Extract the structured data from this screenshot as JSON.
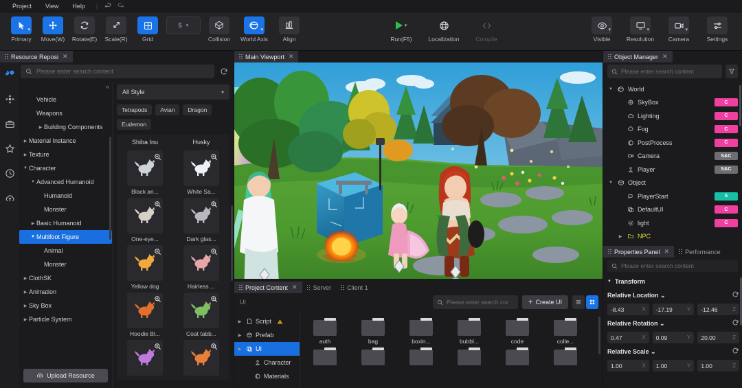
{
  "menu": {
    "items": [
      "Project",
      "View",
      "Help"
    ],
    "separator": "|",
    "undo_icon": "undo-icon",
    "redo_icon": "redo-icon"
  },
  "toolbar": {
    "left_tools": [
      {
        "label": "Primary",
        "icon": "cursor-icon",
        "active": true,
        "caret": true
      },
      {
        "label": "Move(W)",
        "icon": "move-arrows-icon",
        "active": true,
        "caret": false
      },
      {
        "label": "Rotate(E)",
        "icon": "rotate-icon",
        "active": false,
        "caret": false
      },
      {
        "label": "Scale(R)",
        "icon": "scale-diagonal-icon",
        "active": false,
        "caret": false
      },
      {
        "label": "Grid",
        "icon": "grid-icon",
        "active": true,
        "caret": false
      }
    ],
    "grid_value": "5",
    "mid_tools": [
      {
        "label": "Collision",
        "icon": "collision-octahedron-icon",
        "active": false,
        "caret": false
      },
      {
        "label": "World Axis",
        "icon": "world-axis-globe-icon",
        "active": true,
        "caret": true
      },
      {
        "label": "Align",
        "icon": "align-bars-icon",
        "active": false,
        "caret": false
      }
    ],
    "center_tools": [
      {
        "label": "Run(F5)",
        "icon": "play-icon",
        "caret": true,
        "disabled": false
      },
      {
        "label": "Localization",
        "icon": "globe-icon",
        "caret": false,
        "disabled": false
      },
      {
        "label": "Compile",
        "icon": "code-brackets-icon",
        "caret": false,
        "disabled": true
      }
    ],
    "right_tools": [
      {
        "label": "Visible",
        "icon": "eye-icon",
        "caret": true
      },
      {
        "label": "Resolution",
        "icon": "monitor-icon",
        "caret": true
      },
      {
        "label": "Camera",
        "icon": "video-camera-icon",
        "caret": true
      },
      {
        "label": "Settings",
        "icon": "sliders-icon",
        "caret": false
      }
    ]
  },
  "rail": {
    "items": [
      {
        "icon": "resource-library-icon",
        "active": true
      },
      {
        "icon": "move-gizmo-icon",
        "active": false
      },
      {
        "icon": "toolbox-icon",
        "active": false
      },
      {
        "icon": "star-icon",
        "active": false
      },
      {
        "icon": "clock-recent-icon",
        "active": false
      },
      {
        "icon": "cloud-upload-icon",
        "active": false
      }
    ]
  },
  "resource_panel": {
    "tab": "Resource Reposi",
    "tab_close": "✕",
    "search_placeholder": "Please enter search content",
    "search_icon": "search-icon",
    "refresh_icon": "refresh-icon",
    "collapse_icon": "«",
    "tree": [
      {
        "label": "Vehicle",
        "depth": 1,
        "arrow": ""
      },
      {
        "label": "Weapons",
        "depth": 1,
        "arrow": ""
      },
      {
        "label": "Building Components",
        "depth": 2,
        "arrow": "▶"
      },
      {
        "label": "Material Instance",
        "depth": 0,
        "arrow": "▶"
      },
      {
        "label": "Texture",
        "depth": 0,
        "arrow": "▶"
      },
      {
        "label": "Character",
        "depth": 0,
        "arrow": "▼"
      },
      {
        "label": "Advanced Humanoid",
        "depth": 1,
        "arrow": "▼"
      },
      {
        "label": "Humanoid",
        "depth": 2,
        "arrow": ""
      },
      {
        "label": "Monster",
        "depth": 2,
        "arrow": ""
      },
      {
        "label": "Basic Humanoid",
        "depth": 1,
        "arrow": "▶"
      },
      {
        "label": "Multifoot Figure",
        "depth": 1,
        "arrow": "▼",
        "selected": true
      },
      {
        "label": "Animal",
        "depth": 2,
        "arrow": ""
      },
      {
        "label": "Monster",
        "depth": 2,
        "arrow": ""
      },
      {
        "label": "ClothSK",
        "depth": 0,
        "arrow": "▶"
      },
      {
        "label": "Animation",
        "depth": 0,
        "arrow": "▶"
      },
      {
        "label": "Sky Box",
        "depth": 0,
        "arrow": "▶"
      },
      {
        "label": "Particle System",
        "depth": 0,
        "arrow": "▶"
      }
    ],
    "upload_button": "Upload Resource",
    "upload_icon": "upload-cloud-icon",
    "style_select": "All Style",
    "style_caret": "⌄",
    "chips": [
      "Tetrapods",
      "Avian",
      "Dragon",
      "Eudemon"
    ],
    "groups": [
      "Shiba Inu",
      "Husky"
    ],
    "cards": [
      {
        "name": "Black an...",
        "glyph": "🐕",
        "tint": "#cfd3d6"
      },
      {
        "name": "White Sa...",
        "glyph": "🐕",
        "tint": "#eef1f3"
      },
      {
        "name": "One-eye...",
        "glyph": "🐕",
        "tint": "#d8cfc8"
      },
      {
        "name": "Dark glas...",
        "glyph": "🐕",
        "tint": "#b8b9bd"
      },
      {
        "name": "Yellow dog",
        "glyph": "🐕",
        "tint": "#f0a93c"
      },
      {
        "name": "Hairless ...",
        "glyph": "🐕",
        "tint": "#e8a6a8"
      },
      {
        "name": "Hoodie Bl...",
        "glyph": "🐕",
        "tint": "#e0702a"
      },
      {
        "name": "Coat tabb...",
        "glyph": "🐕",
        "tint": "#7fbf62"
      },
      {
        "name": "",
        "glyph": "🐕",
        "tint": "#c07adf"
      },
      {
        "name": "",
        "glyph": "🐕",
        "tint": "#e8803a"
      }
    ],
    "zoom_icon": "magnifier-icon"
  },
  "viewport": {
    "tab": "Main Viewport",
    "tab_close": "✕",
    "scene_description": "3D game scene with characters in a forest clearing"
  },
  "project_content": {
    "tabs": [
      {
        "label": "Project Content",
        "active": true,
        "close": "✕"
      },
      {
        "label": "Server",
        "active": false
      },
      {
        "label": "Client 1",
        "active": false
      }
    ],
    "path": "UI",
    "search_placeholder": "Please enter search cor",
    "search_icon": "search-icon",
    "create_button": "Create UI",
    "create_icon": "plus-icon",
    "view_list_icon": "list-view-icon",
    "view_grid_icon": "grid-view-icon",
    "tree": [
      {
        "label": "Script",
        "arrow": "▶",
        "icon": "file-icon",
        "warn": true,
        "depth": 0
      },
      {
        "label": "Prefab",
        "arrow": "▶",
        "icon": "prefab-icon",
        "depth": 0
      },
      {
        "label": "UI",
        "arrow": "▶",
        "icon": "ui-icon",
        "depth": 0,
        "selected": true
      },
      {
        "label": "Character",
        "arrow": "",
        "icon": "character-icon",
        "depth": 1
      },
      {
        "label": "Materials",
        "arrow": "",
        "icon": "materials-icon",
        "depth": 1
      }
    ],
    "folders_row1": [
      "auth",
      "bag",
      "boxin...",
      "bubbl...",
      "code",
      "colle..."
    ],
    "folders_row2": [
      "",
      "",
      "",
      "",
      "",
      ""
    ]
  },
  "object_manager": {
    "tab": "Object Manager",
    "tab_close": "✕",
    "search_placeholder": "Please enter search content",
    "search_icon": "search-icon",
    "filter_icon": "filter-funnel-icon",
    "nodes": [
      {
        "label": "World",
        "depth": 0,
        "arrow": "▼",
        "icon": "world-globe-icon",
        "badge": ""
      },
      {
        "label": "SkyBox",
        "depth": 1,
        "arrow": "",
        "icon": "skybox-icon",
        "badge": "C",
        "badge_type": "c"
      },
      {
        "label": "Lighting",
        "depth": 1,
        "arrow": "",
        "icon": "lighting-cloud-icon",
        "badge": "C",
        "badge_type": "c"
      },
      {
        "label": "Fog",
        "depth": 1,
        "arrow": "",
        "icon": "fog-icon",
        "badge": "C",
        "badge_type": "c"
      },
      {
        "label": "PostProcess",
        "depth": 1,
        "arrow": "",
        "icon": "postprocess-icon",
        "badge": "C",
        "badge_type": "c"
      },
      {
        "label": "Camera",
        "depth": 1,
        "arrow": "",
        "icon": "camera-icon",
        "badge": "S&C",
        "badge_type": "ssc"
      },
      {
        "label": "Player",
        "depth": 1,
        "arrow": "",
        "icon": "player-icon",
        "badge": "S&C",
        "badge_type": "ssc"
      },
      {
        "label": "Object",
        "depth": 0,
        "arrow": "▼",
        "icon": "object-cube-icon",
        "badge": ""
      },
      {
        "label": "PlayerStart",
        "depth": 1,
        "arrow": "",
        "icon": "playerstart-flag-icon",
        "badge": "S",
        "badge_type": "s"
      },
      {
        "label": "DefaultUI",
        "depth": 1,
        "arrow": "",
        "icon": "defaultui-icon",
        "badge": "C",
        "badge_type": "c"
      },
      {
        "label": "light",
        "depth": 1,
        "arrow": "",
        "icon": "light-bulb-icon",
        "badge": "C",
        "badge_type": "c"
      },
      {
        "label": "NPC",
        "depth": 1,
        "arrow": "▶",
        "icon": "folder-icon",
        "badge": "",
        "highlight": "#d8d83a"
      }
    ]
  },
  "properties": {
    "tabs": [
      {
        "label": "Properties Panel",
        "active": true,
        "close": "✕"
      },
      {
        "label": "Performance",
        "active": false
      }
    ],
    "search_placeholder": "Please enter search content",
    "search_icon": "search-icon",
    "section": "Transform",
    "section_arrow": "▼",
    "reset_icon": "reset-circular-arrow-icon",
    "groups": [
      {
        "label": "Relative Location",
        "caret": "⌄",
        "fields": [
          {
            "value": "-8.43",
            "axis": "X"
          },
          {
            "value": "-17.19",
            "axis": "Y"
          },
          {
            "value": "-12.46",
            "axis": "Z"
          }
        ]
      },
      {
        "label": "Relative Rotation",
        "caret": "⌄",
        "fields": [
          {
            "value": "0.47",
            "axis": "X"
          },
          {
            "value": "0.09",
            "axis": "Y"
          },
          {
            "value": "20.00",
            "axis": "Z"
          }
        ]
      },
      {
        "label": "Relative Scale",
        "caret": "⌄",
        "fields": [
          {
            "value": "1.00",
            "axis": "X"
          },
          {
            "value": "1.00",
            "axis": "Y"
          },
          {
            "value": "1.00",
            "axis": "Z"
          }
        ]
      }
    ]
  },
  "colors": {
    "accent": "#1a74e8",
    "badge_c": "#ef3fa0",
    "badge_s": "#16c0a6",
    "badge_ssc": "#6d6d73",
    "npc_yellow": "#d8d83a",
    "run_green": "#2fbf4e"
  }
}
